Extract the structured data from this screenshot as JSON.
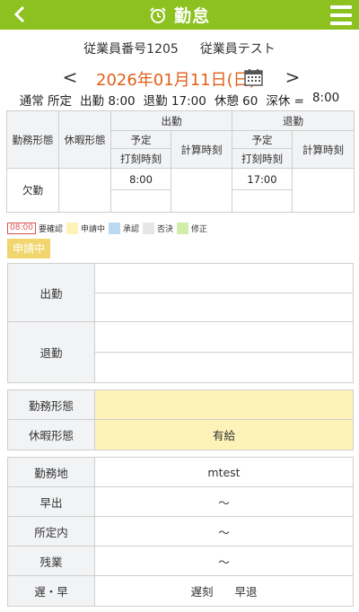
{
  "header": {
    "title": "勤怠",
    "back_icon": "chevron-left-icon",
    "clock_icon": "alarm-clock-icon",
    "menu_icon": "hamburger-menu-icon",
    "bg_color": "#8cc11f"
  },
  "employee": {
    "number": "従業員番号1205",
    "name": "従業員テスト"
  },
  "date_nav": {
    "prev": "<",
    "date": "2026年01月11日(日)",
    "next": ">",
    "date_color": "#e0601a",
    "calendar_icon": "calendar-icon"
  },
  "summary": {
    "pattern": "通常 所定",
    "clock_in": "出勤 8:00",
    "clock_out": "退勤 17:00",
    "break": "休憩 60",
    "late_night": "深休 =",
    "late_night_value": "8:00"
  },
  "grid": {
    "kinmu_keitai": "勤務形態",
    "kyuka_keitai": "休暇形態",
    "shukkin": "出勤",
    "taikin": "退勤",
    "yotei": "予定",
    "dakoku": "打刻時刻",
    "keisan": "計算時刻",
    "row": {
      "kinmu": "欠勤",
      "kyuka": "",
      "in_yotei": "8:00",
      "in_dakoku": "",
      "in_keisan": "",
      "out_yotei": "17:00",
      "out_dakoku": "",
      "out_keisan": ""
    }
  },
  "legend": [
    {
      "label": "要確認",
      "sample": "08:00",
      "color": "#d9534f"
    },
    {
      "label": "申請中",
      "color": "#fdf3b9"
    },
    {
      "label": "承認",
      "color": "#bcd9f2"
    },
    {
      "label": "否決",
      "color": "#e6e6e6"
    },
    {
      "label": "修正",
      "color": "#d2eca9"
    }
  ],
  "status_badge": "申請中",
  "time_section": {
    "in_label": "出勤",
    "out_label": "退勤"
  },
  "type_section": {
    "kinmu_label": "勤務形態",
    "kinmu_value": "",
    "kyuka_label": "休暇形態",
    "kyuka_value": "有給"
  },
  "detail_section": [
    {
      "label": "勤務地",
      "value": "mtest"
    },
    {
      "label": "早出",
      "value": "〜"
    },
    {
      "label": "所定内",
      "value": "〜"
    },
    {
      "label": "残業",
      "value": "〜"
    },
    {
      "label": "遅・早",
      "value_a": "遅刻",
      "value_b": "早退"
    }
  ]
}
